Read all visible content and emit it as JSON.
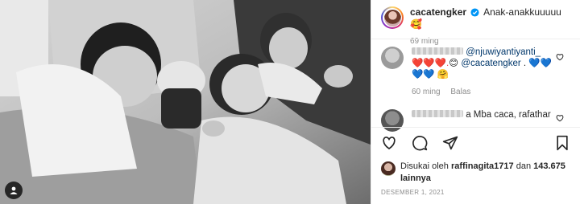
{
  "post": {
    "author": {
      "username": "cacatengker",
      "caption": "Anak-anakkuuuuu",
      "caption_emoji": "🥰",
      "time": "69 ming"
    },
    "comments": [
      {
        "mention": "@njuwiyantiyanti_",
        "hearts_red": "❤️❤️❤️.",
        "face": "😊",
        "mention2": "@cacatengker",
        "tail": " .",
        "hearts_blue_1": "💙💙",
        "hearts_blue_2": "💙💙",
        "hug": "🤗",
        "time": "60 ming",
        "reply_label": "Balas"
      },
      {
        "text": "a Mba caca, rafathar"
      }
    ],
    "likes": {
      "prefix": "Disukai oleh",
      "user": "raffinagita1717",
      "middle": "dan",
      "count": "143.675",
      "suffix": "lainnya"
    },
    "date": "DESEMBER 1, 2021"
  },
  "colors": {
    "like_red": "#ed4956",
    "mention_blue": "#00376b",
    "muted_gray": "#8e8e8e",
    "verified_blue": "#0095f6"
  },
  "icons": [
    "user-tag-icon",
    "verified-icon",
    "heart-icon",
    "comment-icon",
    "share-icon",
    "bookmark-icon"
  ]
}
